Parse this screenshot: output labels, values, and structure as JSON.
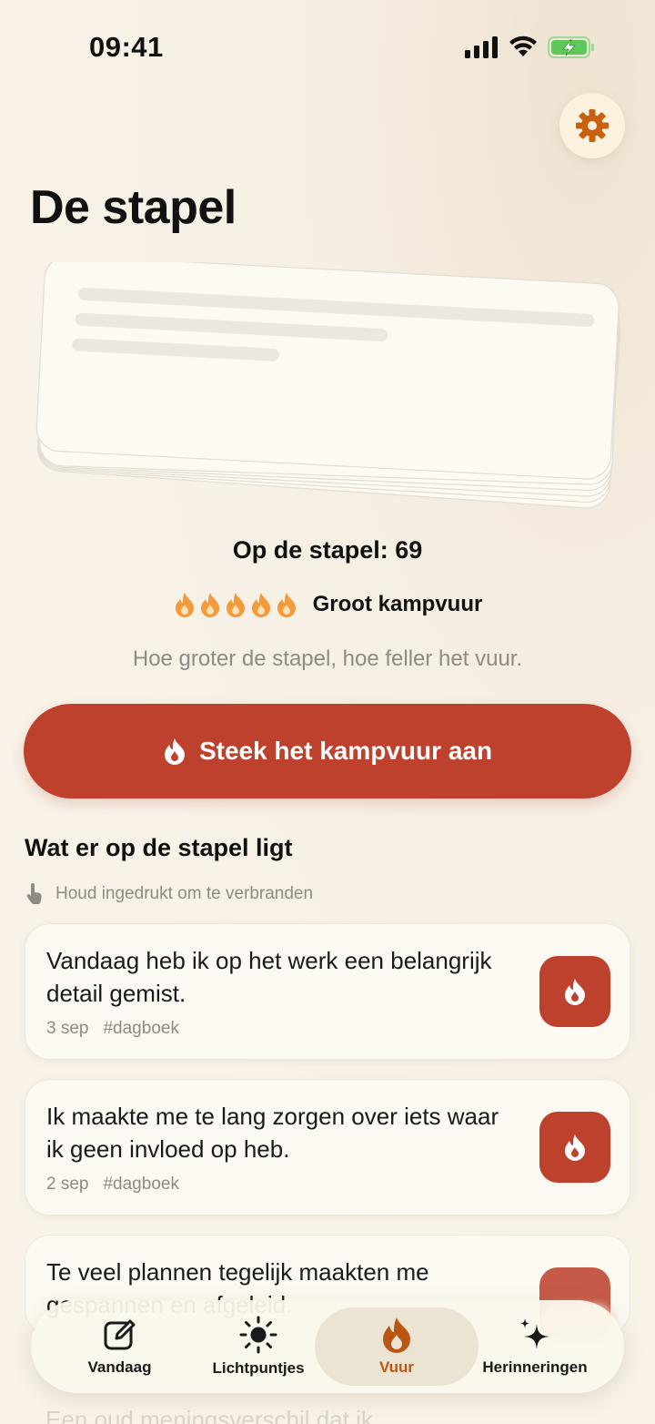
{
  "status_bar": {
    "time": "09:41"
  },
  "page": {
    "title": "De stapel"
  },
  "stack": {
    "count_text": "Op de stapel: 69",
    "flame_count": 5,
    "fire_level": "Groot kampvuur",
    "hint": "Hoe groter de stapel, hoe feller het vuur."
  },
  "ignite_button": {
    "label": "Steek het kampvuur aan"
  },
  "section": {
    "title": "Wat er op de stapel ligt",
    "hold_hint": "Houd ingedrukt om te verbranden"
  },
  "entries": [
    {
      "text": "Vandaag heb ik op het werk een belangrijk detail gemist.",
      "date": "3 sep",
      "tag": "#dagboek"
    },
    {
      "text": "Ik maakte me te lang zorgen over iets waar ik geen invloed op heb.",
      "date": "2 sep",
      "tag": "#dagboek"
    },
    {
      "text": "Te veel plannen tegelijk maakten me gespannen en afgeleid.",
      "date": "",
      "tag": ""
    }
  ],
  "bottom_fade_text": "Een oud meningsverschil dat ik",
  "tabs": [
    {
      "label": "Vandaag",
      "icon": "edit-icon",
      "active": false
    },
    {
      "label": "Lichtpuntjes",
      "icon": "sun-icon",
      "active": false
    },
    {
      "label": "Vuur",
      "icon": "flame-icon",
      "active": true
    },
    {
      "label": "Herinneringen",
      "icon": "sparkles-icon",
      "active": false
    }
  ],
  "colors": {
    "accent": "#be412d",
    "active_tab": "#bb5513",
    "flame": "#f39a3b",
    "background": "#f8f2e8"
  }
}
